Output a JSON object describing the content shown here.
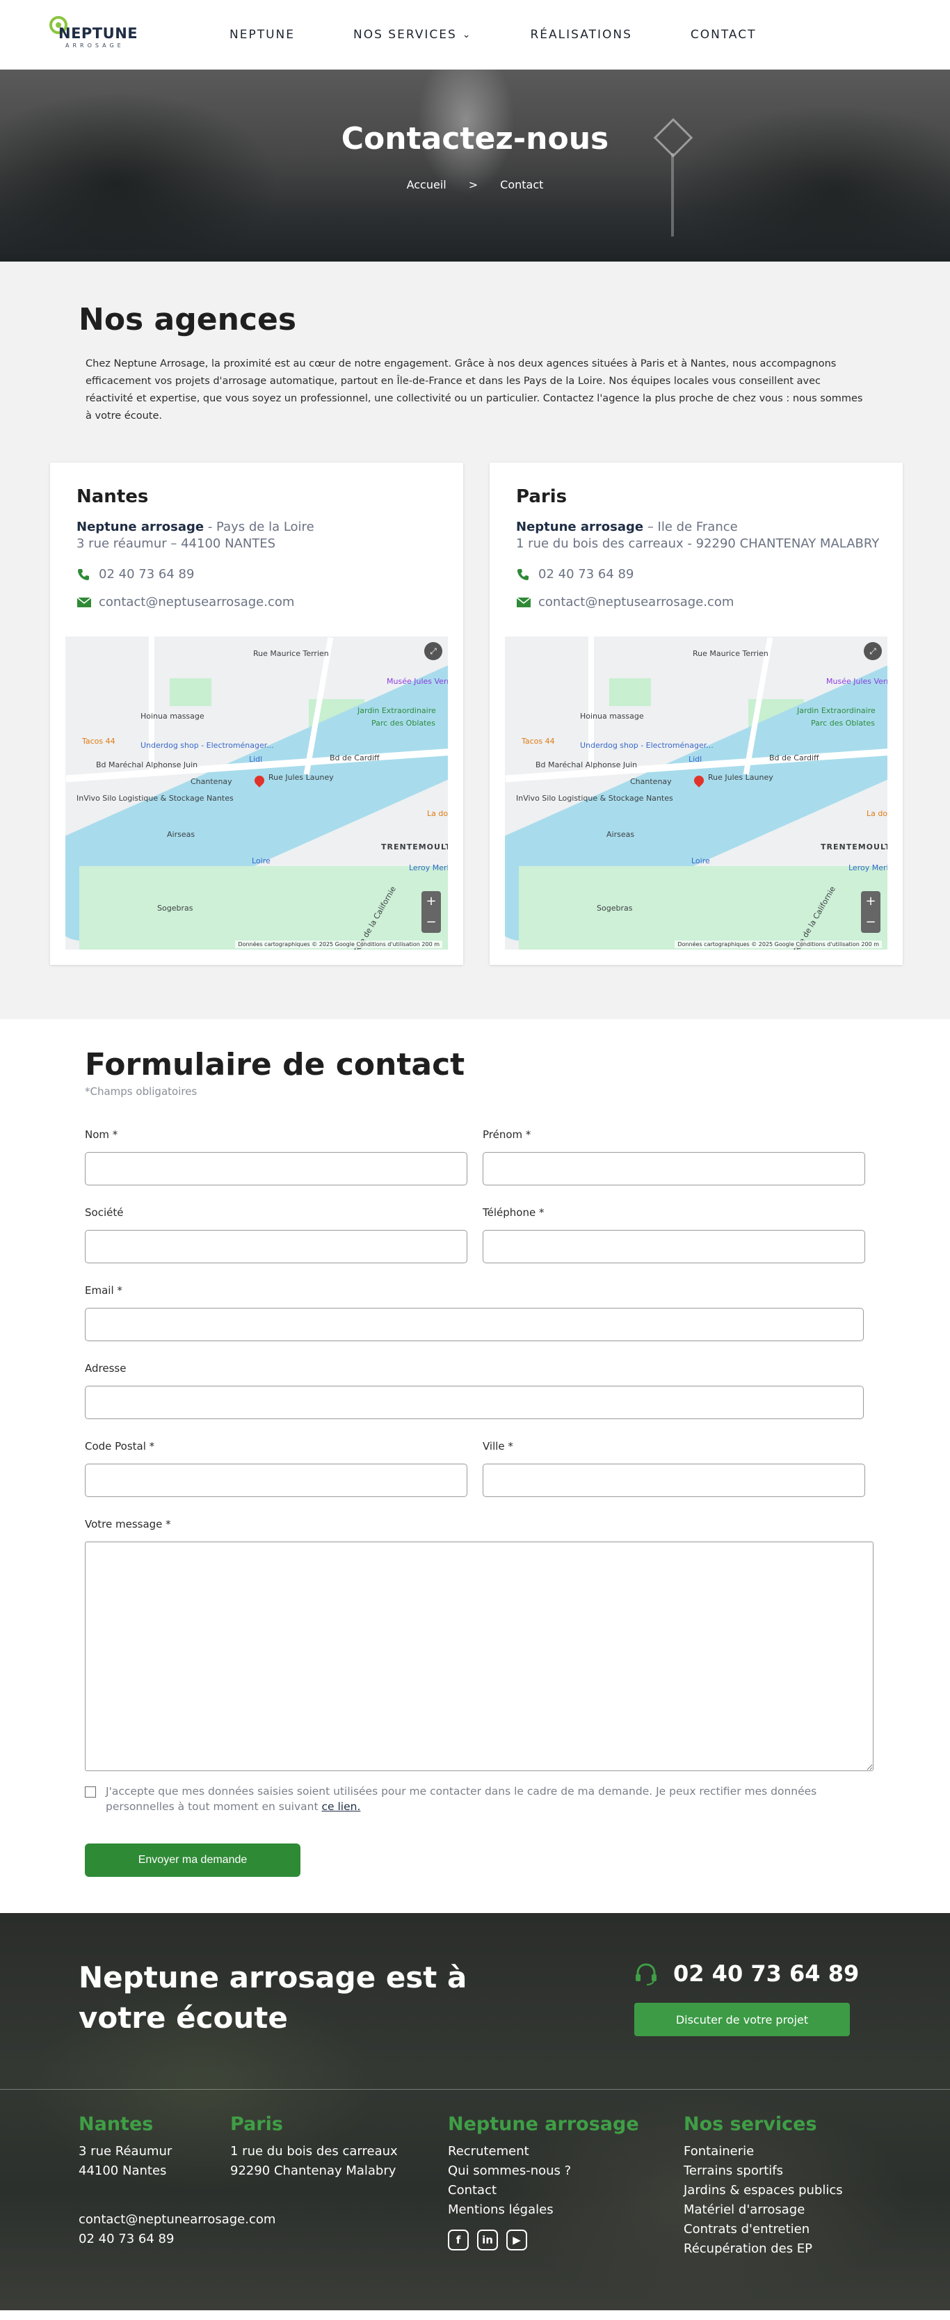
{
  "brand": {
    "logo_word": "NEPTUNE",
    "logo_sub": "ARROSAGE"
  },
  "nav": {
    "items": [
      "NEPTUNE",
      "NOS SERVICES",
      "RÉALISATIONS",
      "CONTACT"
    ]
  },
  "hero": {
    "title": "Contactez-nous",
    "breadcrumb": {
      "home": "Accueil",
      "sep": ">",
      "current": "Contact"
    }
  },
  "agencies": {
    "title": "Nos agences",
    "intro": "Chez Neptune Arrosage, la proximité est au cœur de notre engagement. Grâce à nos deux agences situées à Paris et à Nantes, nous accompagnons efficacement vos projets d'arrosage automatique, partout en Île-de-France et dans les Pays de la Loire. Nos équipes locales vous conseillent avec réactivité et expertise, que vous soyez un professionnel, une collectivité ou un particulier. Contactez l'agence la plus proche de chez vous : nous sommes à votre écoute.",
    "cards": [
      {
        "city": "Nantes",
        "company": "Neptune arrosage",
        "region": " - Pays de la Loire",
        "address": "3 rue réaumur – 44100 NANTES",
        "phone": "02 40 73 64 89",
        "email": "contact@neptusearrosage.com"
      },
      {
        "city": "Paris",
        "company": "Neptune arrosage",
        "region": " – Ile de France",
        "address": "1 rue du bois des carreaux - 92290 CHANTENAY MALABRY",
        "phone": "02 40 73 64 89",
        "email": "contact@neptusearrosage.com"
      }
    ],
    "map": {
      "labels": {
        "l1": "Rue Maurice Terrien",
        "l2": "Musée Jules Verne",
        "l3": "Hoinua massage",
        "l4": "Jardin Extraordinaire",
        "l5": "Parc des Oblates",
        "l6": "Tacos 44",
        "l7": "Underdog shop - Electroménager...",
        "l8": "Lidl",
        "l9": "Bd Maréchal Alphonse Juin",
        "l10": "Chantenay",
        "l11": "Rue Jules Launey",
        "l12": "Bd de Cardiff",
        "l13": "InVivo Silo Logistique & Stockage Nantes",
        "l14": "Airseas",
        "l15": "La dou",
        "l16": "TRENTEMOULT",
        "l17": "Loire",
        "l18": "Leroy Merlin Nantes Re...",
        "l19": "Sogebras",
        "l20": "Rue de la Californie"
      },
      "copyright": "Données cartographiques © 2025 Google   Conditions d'utilisation   200 m"
    }
  },
  "form": {
    "title": "Formulaire de contact",
    "required_note": "*Champs obligatoires",
    "labels": {
      "nom": "Nom *",
      "prenom": "Prénom *",
      "societe": "Société",
      "telephone": "Téléphone *",
      "email": "Email *",
      "adresse": "Adresse",
      "code_postal": "Code Postal *",
      "ville": "Ville *",
      "message": "Votre message *"
    },
    "consent_text": "J'accepte que mes données saisies soient utilisées pour me contacter dans le cadre de ma demande. Je peux rectifier mes données personnelles à tout moment en suivant ",
    "consent_link": "ce lien.",
    "submit": "Envoyer ma demande"
  },
  "footer": {
    "cta": "Neptune arrosage est à votre écoute",
    "phone": "02 40 73 64 89",
    "button": "Discuter de votre projet",
    "nantes": {
      "title": "Nantes",
      "line1": "3 rue Réaumur",
      "line2": "44100 Nantes",
      "email": "contact@neptunearrosage.com",
      "phone": "02 40 73 64 89"
    },
    "paris": {
      "title": "Paris",
      "line1": "1 rue du bois des carreaux",
      "line2": "92290 Chantenay Malabry"
    },
    "neptune": {
      "title": "Neptune arrosage",
      "links": [
        "Recrutement",
        "Qui sommes-nous ?",
        "Contact",
        "Mentions légales"
      ]
    },
    "services": {
      "title": "Nos services",
      "links": [
        "Fontainerie",
        "Terrains sportifs",
        "Jardins & espaces publics",
        "Matériel d'arrosage",
        "Contrats d'entretien",
        "Récupération des EP"
      ]
    },
    "social": {
      "facebook": "f",
      "linkedin": "in",
      "youtube": "▶"
    }
  },
  "colors": {
    "brand_green": "#2f8a36",
    "footer_green": "#3f9e46",
    "navy": "#1f2d44"
  },
  "icons": [
    "phone-icon",
    "mail-icon",
    "chevron-down-icon",
    "headset-icon",
    "facebook-icon",
    "linkedin-icon",
    "youtube-icon"
  ]
}
